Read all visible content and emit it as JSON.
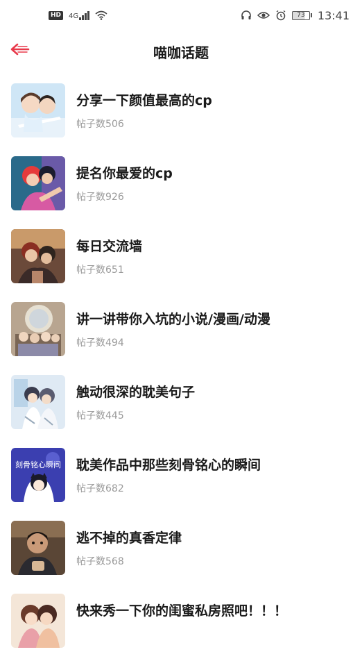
{
  "status_bar": {
    "hd": "HD",
    "network": "4G",
    "battery": "73",
    "time": "13:41"
  },
  "header": {
    "title": "喵咖话题"
  },
  "topics": [
    {
      "title": "分享一下颜值最高的cp",
      "count_label": "帖子数506",
      "count": 506
    },
    {
      "title": "提名你最爱的cp",
      "count_label": "帖子数926",
      "count": 926
    },
    {
      "title": "每日交流墙",
      "count_label": "帖子数651",
      "count": 651
    },
    {
      "title": "讲一讲带你入坑的小说/漫画/动漫",
      "count_label": "帖子数494",
      "count": 494
    },
    {
      "title": "触动很深的耽美句子",
      "count_label": "帖子数445",
      "count": 445
    },
    {
      "title": "耽美作品中那些刻骨铭心的瞬间",
      "count_label": "帖子数682",
      "count": 682
    },
    {
      "title": "逃不掉的真香定律",
      "count_label": "帖子数568",
      "count": 568
    },
    {
      "title": "快来秀一下你的闺蜜私房照吧！！！",
      "count_label": "",
      "count": null
    }
  ],
  "thumb_texts": {
    "moment_thumb": "刻骨铭心瞬间"
  },
  "colors": {
    "back_arrow": "#e8394a",
    "title": "#1a1a1a",
    "count": "#9a9a9a"
  }
}
